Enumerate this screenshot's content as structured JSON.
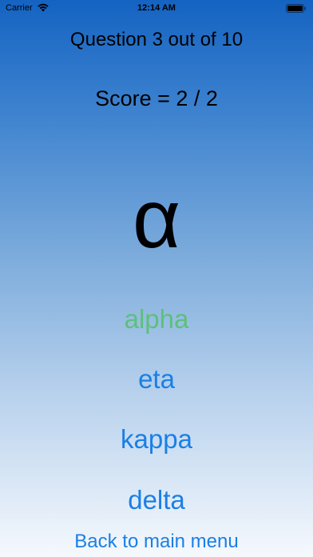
{
  "status_bar": {
    "carrier": "Carrier",
    "time": "12:14 AM",
    "wifi_icon": "wifi-icon",
    "battery_icon": "battery-icon"
  },
  "quiz": {
    "question_label": "Question 3 out of 10",
    "score_label": "Score = 2 / 2",
    "symbol": "α"
  },
  "answers": [
    {
      "label": "alpha",
      "color": "#5cc07a"
    },
    {
      "label": "eta",
      "color": "#1a7fe6"
    },
    {
      "label": "kappa",
      "color": "#1a7fe6"
    },
    {
      "label": "delta",
      "color": "#1a7fe6"
    }
  ],
  "navigation": {
    "back_label": "Back to main menu"
  },
  "colors": {
    "accent": "#1a7fe6",
    "correct": "#5cc07a",
    "gradient_top": "#1463c2",
    "gradient_bottom": "#f5f9fd"
  }
}
